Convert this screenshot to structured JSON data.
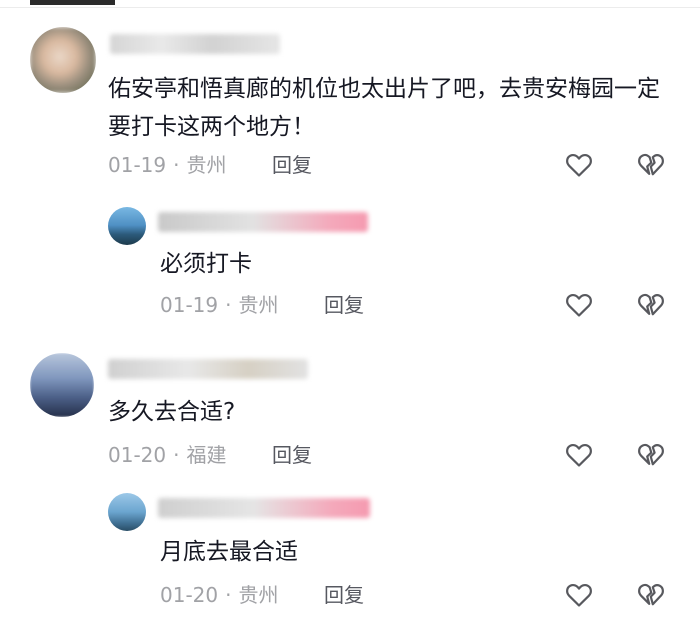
{
  "comments": [
    {
      "text": "佑安亭和悟真廊的机位也太出片了吧，去贵安梅园一定要打卡这两个地方！",
      "date": "01-19",
      "location": "贵州",
      "reply_label": "回复",
      "is_reply": false
    },
    {
      "text": "必须打卡",
      "date": "01-19",
      "location": "贵州",
      "reply_label": "回复",
      "is_reply": true
    },
    {
      "text": "多久去合适?",
      "date": "01-20",
      "location": "福建",
      "reply_label": "回复",
      "is_reply": false
    },
    {
      "text": "月底去最合适",
      "date": "01-20",
      "location": "贵州",
      "reply_label": "回复",
      "is_reply": true
    }
  ],
  "separator": "·",
  "icons": {
    "like": "heart-outline-icon",
    "dislike": "broken-heart-icon"
  },
  "colors": {
    "text": "#161823",
    "meta": "#a1a2a6",
    "reply": "#565860",
    "icon": "#58595e",
    "author_badge": "#f59ab0"
  }
}
